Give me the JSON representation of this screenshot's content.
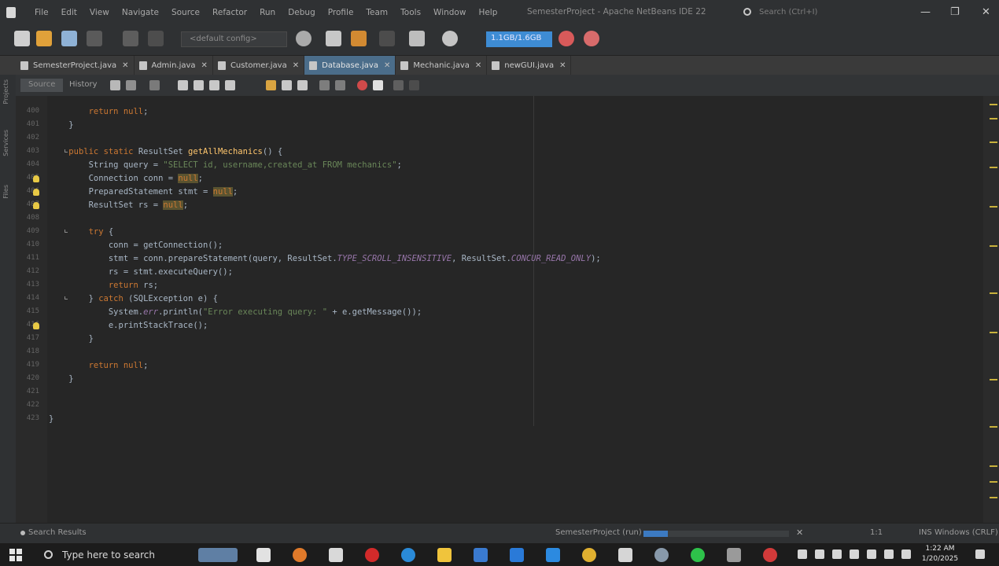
{
  "window": {
    "title": "SemesterProject - Apache NetBeans IDE 22"
  },
  "menu": [
    "File",
    "Edit",
    "View",
    "Navigate",
    "Source",
    "Refactor",
    "Run",
    "Debug",
    "Profile",
    "Team",
    "Tools",
    "Window",
    "Help"
  ],
  "search": {
    "placeholder": "Search (Ctrl+I)"
  },
  "toolbar": {
    "config": "<default config>",
    "memory": "1.1GB/1.6GB"
  },
  "tabs": [
    {
      "label": "SemesterProject.java"
    },
    {
      "label": "Admin.java"
    },
    {
      "label": "Customer.java"
    },
    {
      "label": "Database.java",
      "active": true
    },
    {
      "label": "Mechanic.java"
    },
    {
      "label": "newGUI.java"
    }
  ],
  "editor_tabs": {
    "source": "Source",
    "history": "History"
  },
  "side_labels": [
    "Projects",
    "Services",
    "Files"
  ],
  "code": {
    "lines": [
      {
        "num": "400",
        "text": "        return null;"
      },
      {
        "num": "401",
        "text": "    }"
      },
      {
        "num": "402",
        "text": ""
      },
      {
        "num": "403",
        "text": "    public static ResultSet getAllMechanics() {"
      },
      {
        "num": "404",
        "text": "        String query = \"SELECT id, username,created_at FROM mechanics\";"
      },
      {
        "num": "405",
        "text": "        Connection conn = null;"
      },
      {
        "num": "406",
        "text": "        PreparedStatement stmt = null;"
      },
      {
        "num": "407",
        "text": "        ResultSet rs = null;"
      },
      {
        "num": "408",
        "text": ""
      },
      {
        "num": "409",
        "text": "        try {"
      },
      {
        "num": "410",
        "text": "            conn = getConnection();"
      },
      {
        "num": "411",
        "text": "            stmt = conn.prepareStatement(query, ResultSet.TYPE_SCROLL_INSENSITIVE, ResultSet.CONCUR_READ_ONLY);"
      },
      {
        "num": "412",
        "text": "            rs = stmt.executeQuery();"
      },
      {
        "num": "413",
        "text": "            return rs;"
      },
      {
        "num": "414",
        "text": "        } catch (SQLException e) {"
      },
      {
        "num": "415",
        "text": "            System.err.println(\"Error executing query: \" + e.getMessage());"
      },
      {
        "num": "416",
        "text": "            e.printStackTrace();"
      },
      {
        "num": "417",
        "text": "        }"
      },
      {
        "num": "418",
        "text": ""
      },
      {
        "num": "419",
        "text": "        return null;"
      },
      {
        "num": "420",
        "text": "    }"
      },
      {
        "num": "421",
        "text": ""
      },
      {
        "num": "422",
        "text": ""
      },
      {
        "num": "423",
        "text": "}"
      }
    ]
  },
  "statusbar": {
    "search_results": "Search Results",
    "project": "SemesterProject (run)",
    "progress": 0.17,
    "position": "1:1",
    "mode": "INS Windows (CRLF)"
  },
  "taskbar": {
    "search_placeholder": "Type here to search",
    "time": "1:22 AM",
    "date": "1/20/2025"
  }
}
